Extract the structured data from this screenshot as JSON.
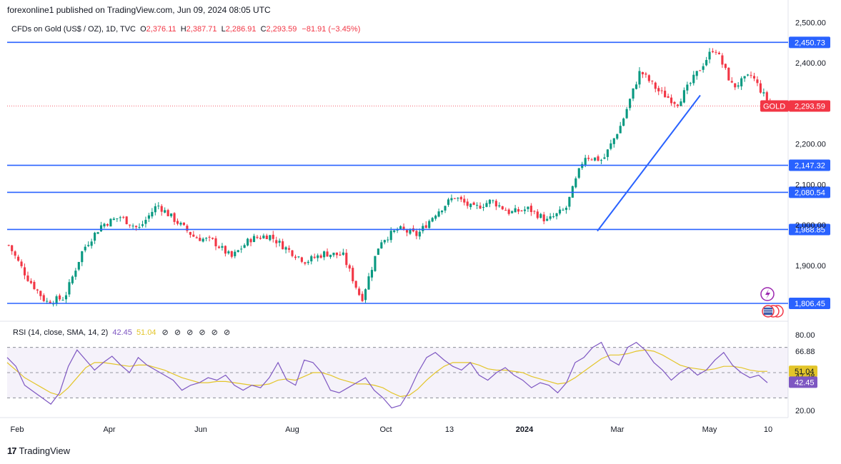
{
  "header": {
    "published": "forexonline1 published on TradingView.com, Jun 09, 2024 08:05 UTC"
  },
  "legend": {
    "symbol": "CFDs on Gold (US$ / OZ), 1D, TVC",
    "open_label": "O",
    "open": "2,376.11",
    "high_label": "H",
    "high": "2,387.71",
    "low_label": "L",
    "low": "2,286.91",
    "close_label": "C",
    "close": "2,293.59",
    "change": "−81.91 (−3.45%)"
  },
  "rsi_legend": {
    "title": "RSI (14, close, SMA, 14, 2)",
    "rsi_value": "42.45",
    "sma_value": "51.04",
    "toggles": [
      "⊘",
      "⊘",
      "⊘",
      "⊘",
      "⊘",
      "⊘"
    ]
  },
  "brand": {
    "logo": "17",
    "name": "TradingView"
  },
  "colors": {
    "up": "#089981",
    "down": "#f23645",
    "hline": "#2962ff",
    "rsi": "#7e57c2",
    "rsi_sma": "#e3c52a",
    "rsi_band": "#7e57c2"
  },
  "chart_data": [
    {
      "type": "candlestick",
      "title": "CFDs on Gold (US$ / OZ), 1D, TVC",
      "x_tick_labels": [
        "Feb",
        "Apr",
        "Jun",
        "Aug",
        "Oct",
        "13",
        "2024",
        "Mar",
        "May",
        "10"
      ],
      "y_ticks": [
        "2,500.00",
        "2,400.00",
        "2,200.00",
        "2,100.00",
        "2,000.00",
        "1,900.00"
      ],
      "ylim": [
        1780,
        2520
      ],
      "horizontal_levels": [
        {
          "value": 2450.73,
          "label": "2,450.73"
        },
        {
          "value": 2147.32,
          "label": "2,147.32"
        },
        {
          "value": 2080.54,
          "label": "2,080.54"
        },
        {
          "value": 1988.85,
          "label": "1,988.85"
        },
        {
          "value": 1806.45,
          "label": "1,806.45"
        }
      ],
      "last_price": {
        "value": 2293.59,
        "label": "2,293.59",
        "symbol": "GOLD"
      },
      "trendline": {
        "from": {
          "x": "Feb 2024",
          "y": 1985
        },
        "to": {
          "x": "Apr 2024",
          "y": 2320
        }
      },
      "price_path": [
        [
          "Jan 2023",
          1950
        ],
        [
          "Feb 2023",
          1870
        ],
        [
          "Feb 2023",
          1810
        ],
        [
          "Mar 2023",
          1820
        ],
        [
          "Mar 2023",
          1940
        ],
        [
          "Apr 2023",
          2000
        ],
        [
          "Apr 2023",
          2020
        ],
        [
          "May 2023",
          1990
        ],
        [
          "May 2023",
          2050
        ],
        [
          "May 2023",
          2010
        ],
        [
          "Jun 2023",
          1970
        ],
        [
          "Jun 2023",
          1960
        ],
        [
          "Jul 2023",
          1920
        ],
        [
          "Jul 2023",
          1965
        ],
        [
          "Jul 2023",
          1975
        ],
        [
          "Aug 2023",
          1940
        ],
        [
          "Aug 2023",
          1910
        ],
        [
          "Sep 2023",
          1930
        ],
        [
          "Sep 2023",
          1925
        ],
        [
          "Oct 2023",
          1815
        ],
        [
          "Oct 2023",
          1960
        ],
        [
          "Oct 2023",
          1990
        ],
        [
          "Nov 2023",
          1975
        ],
        [
          "Nov 2023",
          2030
        ],
        [
          "Dec 2023",
          2070
        ],
        [
          "Dec 2023",
          2040
        ],
        [
          "Jan 2024",
          2060
        ],
        [
          "Jan 2024",
          2030
        ],
        [
          "Feb 2024",
          2040
        ],
        [
          "Feb 2024",
          2010
        ],
        [
          "Mar 2024",
          2040
        ],
        [
          "Mar 2024",
          2170
        ],
        [
          "Mar 2024",
          2160
        ],
        [
          "Apr 2024",
          2250
        ],
        [
          "Apr 2024",
          2380
        ],
        [
          "Apr 2024",
          2330
        ],
        [
          "May 2024",
          2300
        ],
        [
          "May 2024",
          2370
        ],
        [
          "May 2024",
          2440
        ],
        [
          "May 2024",
          2340
        ],
        [
          "Jun 2024",
          2370
        ],
        [
          "Jun 2024",
          2294
        ]
      ]
    },
    {
      "type": "line",
      "title": "RSI (14, close, SMA, 14, 2)",
      "y_ticks": [
        "80.00",
        "20.00"
      ],
      "y_value_labels": [
        {
          "value": 66.88,
          "label": "66.88"
        },
        {
          "value": 51.04,
          "label": "51.04",
          "series": "SMA"
        },
        {
          "value": 47.28,
          "label": "47.28"
        },
        {
          "value": 42.45,
          "label": "42.45",
          "series": "RSI"
        }
      ],
      "band": [
        30,
        70
      ],
      "ylim": [
        16,
        84
      ],
      "rsi_path": [
        62,
        55,
        40,
        35,
        30,
        25,
        34,
        55,
        68,
        60,
        52,
        58,
        63,
        56,
        50,
        62,
        56,
        52,
        48,
        44,
        36,
        40,
        42,
        46,
        44,
        48,
        40,
        36,
        40,
        38,
        46,
        58,
        44,
        40,
        60,
        58,
        50,
        36,
        34,
        38,
        42,
        46,
        36,
        30,
        22,
        24,
        35,
        50,
        62,
        66,
        60,
        55,
        52,
        58,
        48,
        44,
        50,
        54,
        48,
        44,
        38,
        42,
        40,
        34,
        42,
        58,
        62,
        70,
        74,
        60,
        56,
        70,
        74,
        68,
        58,
        52,
        44,
        50,
        54,
        48,
        52,
        60,
        66,
        56,
        50,
        46,
        48,
        42
      ],
      "sma_path": [
        58,
        52,
        46,
        42,
        38,
        34,
        32,
        38,
        46,
        54,
        58,
        58,
        57,
        56,
        55,
        56,
        56,
        54,
        52,
        49,
        46,
        44,
        42,
        42,
        43,
        43,
        42,
        41,
        40,
        40,
        41,
        44,
        45,
        44,
        47,
        50,
        50,
        48,
        45,
        43,
        41,
        41,
        40,
        38,
        34,
        31,
        32,
        37,
        44,
        50,
        55,
        58,
        58,
        58,
        56,
        53,
        52,
        52,
        51,
        50,
        47,
        45,
        43,
        41,
        42,
        46,
        51,
        56,
        61,
        64,
        64,
        65,
        67,
        68,
        67,
        64,
        60,
        56,
        54,
        53,
        52,
        53,
        55,
        55,
        54,
        52,
        51,
        51.04
      ]
    }
  ]
}
